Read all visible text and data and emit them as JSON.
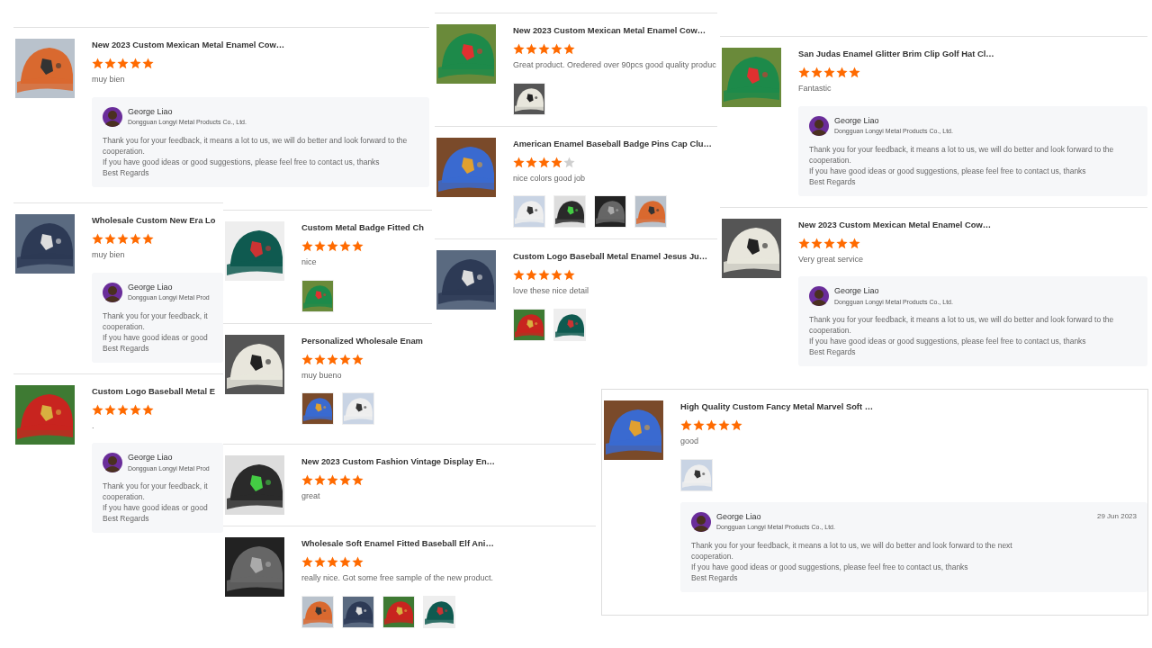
{
  "panels": [
    {
      "reviews": [
        {
          "title": "New 2023 Custom Mexican Metal Enamel Cow…",
          "stars": 5,
          "comment": "muy bien",
          "reply": {
            "name": "George Liao",
            "company": "Dongguan Longyi Metal Products Co., Ltd.",
            "lines": [
              "Thank you for your feedback, it means a lot to us, we will do better and look forward to the",
              "cooperation.",
              "If you have good ideas or good suggestions, please feel free to contact us, thanks",
              "Best Regards"
            ]
          }
        }
      ]
    },
    {
      "reviews": [
        {
          "title": "Wholesale Custom New Era Lo",
          "stars": 5,
          "comment": "muy bien",
          "reply": {
            "name": "George Liao",
            "company": "Dongguan Longyi Metal Prod",
            "lines": [
              "Thank you for your feedback, it",
              "cooperation.",
              "If you have good ideas or good",
              "Best Regards"
            ]
          }
        },
        {
          "title": "Custom Logo Baseball Metal E",
          "stars": 5,
          "comment": ".",
          "reply": {
            "name": "George Liao",
            "company": "Dongguan Longyi Metal Prod",
            "lines": [
              "Thank you for your feedback, it",
              "cooperation.",
              "If you have good ideas or good",
              "Best Regards"
            ]
          }
        }
      ]
    },
    {
      "reviews": [
        {
          "title": "Custom Metal Badge Fitted Ch",
          "stars": 5,
          "comment": "nice",
          "photos": [
            {
              "kind": "picture"
            }
          ]
        },
        {
          "title": "Personalized Wholesale Enam",
          "stars": 5,
          "comment": "muy bueno",
          "photos": [
            {
              "kind": "picture"
            },
            {
              "kind": "picture"
            }
          ]
        }
      ]
    },
    {
      "reviews": [
        {
          "title": "New 2023 Custom Fashion Vintage Display En…",
          "stars": 5,
          "comment": "great"
        },
        {
          "title": "Wholesale Soft Enamel Fitted Baseball Elf Ani…",
          "stars": 5,
          "comment": "really nice. Got some free sample of the new product.",
          "photos": [
            {
              "kind": "picture"
            },
            {
              "kind": "picture"
            },
            {
              "kind": "picture"
            },
            {
              "kind": "picture"
            }
          ]
        }
      ]
    },
    {
      "reviews": [
        {
          "title": "New 2023 Custom Mexican Metal Enamel Cow…",
          "stars": 5,
          "comment": "Great product. Oredered over 90pcs good quality produc",
          "photos": [
            {
              "kind": "picture"
            }
          ]
        },
        {
          "title": "American Enamel Baseball Badge Pins Cap Clu…",
          "stars": 4,
          "comment": "nice colors good job",
          "photos": [
            {
              "kind": "picture"
            },
            {
              "kind": "picture"
            },
            {
              "kind": "picture"
            },
            {
              "kind": "picture"
            }
          ]
        },
        {
          "title": "Custom Logo Baseball Metal Enamel Jesus Ju…",
          "stars": 5,
          "comment": "love these nice detail",
          "photos": [
            {
              "kind": "picture"
            },
            {
              "kind": "picture"
            }
          ]
        }
      ]
    },
    {
      "reviews": [
        {
          "title": "San Judas Enamel Glitter Brim Clip Golf Hat Cl…",
          "stars": 5,
          "comment": "Fantastic",
          "reply": {
            "name": "George Liao",
            "company": "Dongguan Longyi Metal Products Co., Ltd.",
            "lines": [
              "Thank you for your feedback, it means a lot to us, we will do better and look forward to the",
              "cooperation.",
              "If you have good ideas or good suggestions, please feel free to contact us, thanks",
              "Best Regards"
            ]
          }
        },
        {
          "title": "New 2023 Custom Mexican Metal Enamel Cow…",
          "stars": 5,
          "comment": "Very great service",
          "reply": {
            "name": "George Liao",
            "company": "Dongguan Longyi Metal Products Co., Ltd.",
            "lines": [
              "Thank you for your feedback, it means a lot to us, we will do better and look forward to the",
              "cooperation.",
              "If you have good ideas or good suggestions, please feel free to contact us, thanks",
              "Best Regards"
            ]
          }
        }
      ]
    },
    {
      "reviews": [
        {
          "title": "High Quality Custom Fancy Metal Marvel Soft …",
          "stars": 5,
          "comment": "good",
          "photos": [
            {
              "kind": "picture"
            }
          ],
          "reply": {
            "name": "George Liao",
            "company": "Dongguan Longyi Metal Products Co., Ltd.",
            "date": "29 Jun 2023",
            "lines": [
              "Thank you for your feedback, it means a lot to us, we will do better and look forward to the next",
              "cooperation.",
              "If you have good ideas or good suggestions, please feel free to contact us, thanks",
              "Best Regards"
            ]
          }
        }
      ]
    }
  ]
}
